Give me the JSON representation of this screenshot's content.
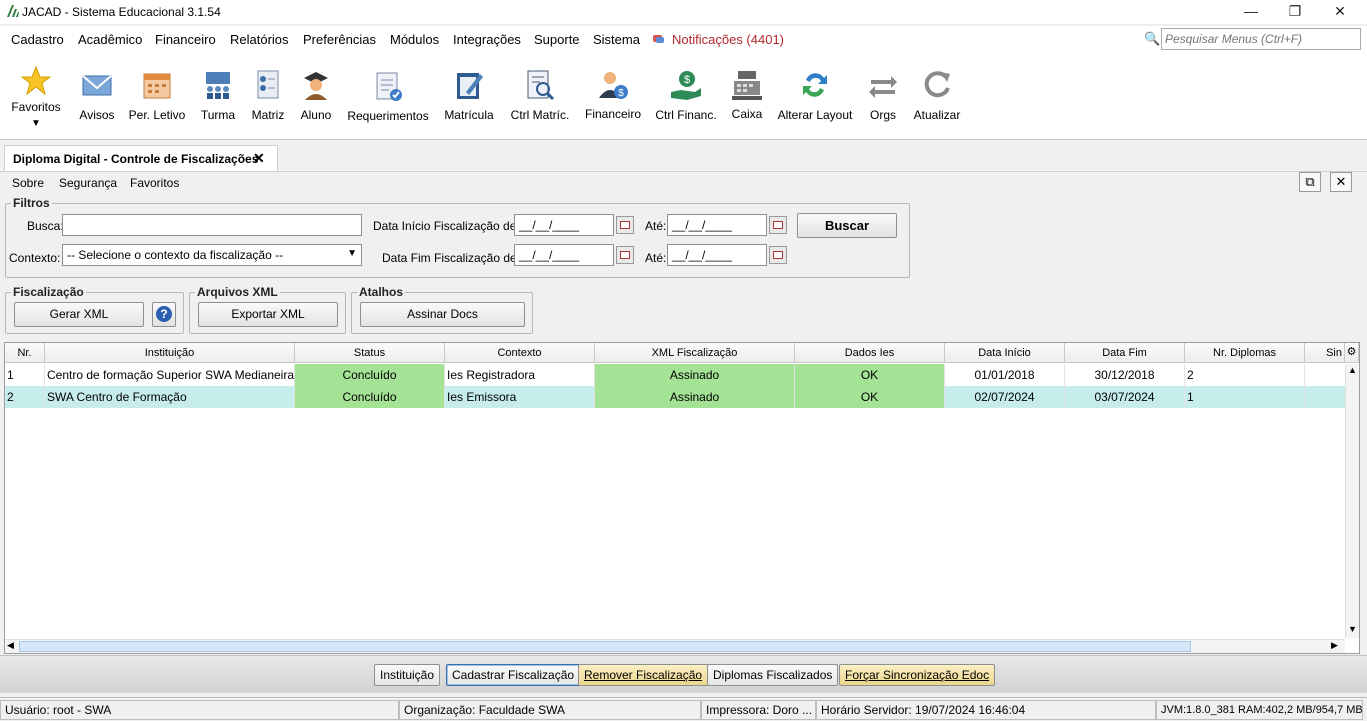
{
  "window": {
    "title": "JACAD - Sistema Educacional 3.1.54"
  },
  "menubar": {
    "items": [
      "Cadastro",
      "Acadêmico",
      "Financeiro",
      "Relatórios",
      "Preferências",
      "Módulos",
      "Integrações",
      "Suporte",
      "Sistema"
    ],
    "notifications": "Notificações (4401)",
    "search_placeholder": "Pesquisar Menus (Ctrl+F)"
  },
  "toolbar": {
    "items": [
      "Favoritos",
      "Avisos",
      "Per. Letivo",
      "Turma",
      "Matriz",
      "Aluno",
      "Requerimentos",
      "Matrícula",
      "Ctrl Matríc.",
      "Financeiro",
      "Ctrl Financ.",
      "Caixa",
      "Alterar Layout",
      "Orgs",
      "Atualizar"
    ]
  },
  "tab": {
    "label": "Diploma Digital - Controle de Fiscalizações"
  },
  "submenu": [
    "Sobre",
    "Segurança",
    "Favoritos"
  ],
  "filters": {
    "legend": "Filtros",
    "busca_label": "Busca:",
    "contexto_label": "Contexto:",
    "contexto_value": "-- Selecione o contexto da fiscalização --",
    "inicio_label": "Data Início Fiscalização de:",
    "fim_label": "Data Fim Fiscalização de:",
    "ate_label": "Até:",
    "date_mask": "__/__/____",
    "buscar": "Buscar"
  },
  "groups": {
    "fiscalizacao": {
      "legend": "Fiscalização",
      "button": "Gerar XML"
    },
    "arquivos": {
      "legend": "Arquivos XML",
      "button": "Exportar XML"
    },
    "atalhos": {
      "legend": "Atalhos",
      "button": "Assinar Docs"
    }
  },
  "table": {
    "headers": [
      "Nr.",
      "Instituição",
      "Status",
      "Contexto",
      "XML Fiscalização",
      "Dados Ies",
      "Data Início",
      "Data Fim",
      "Nr. Diplomas",
      "Sin"
    ],
    "rows": [
      [
        "1",
        "Centro de formação Superior SWA Medianeira",
        "Concluído",
        "Ies Registradora",
        "Assinado",
        "OK",
        "01/01/2018",
        "30/12/2018",
        "2"
      ],
      [
        "2",
        "SWA Centro de Formação",
        "Concluído",
        "Ies Emissora",
        "Assinado",
        "OK",
        "02/07/2024",
        "03/07/2024",
        "1"
      ]
    ]
  },
  "actions": {
    "instituicao": "Instituição",
    "cadastrar": "Cadastrar Fiscalização",
    "remover": "Remover Fiscalização",
    "diplomas": "Diplomas Fiscalizados",
    "forcar": "Forçar Sincronização Edoc"
  },
  "status": {
    "usuario": "Usuário: root - SWA",
    "organizacao": "Organização: Faculdade SWA",
    "impressora": "Impressora: Doro ...",
    "horario": "Horário Servidor: 19/07/2024 16:46:04",
    "jvm": "JVM:1.8.0_381  RAM:402,2 MB/954,7 MB"
  },
  "colors": {
    "accent_green": "#a4e396",
    "selected_row": "#c6ecec",
    "notification_red": "#b3282d"
  }
}
